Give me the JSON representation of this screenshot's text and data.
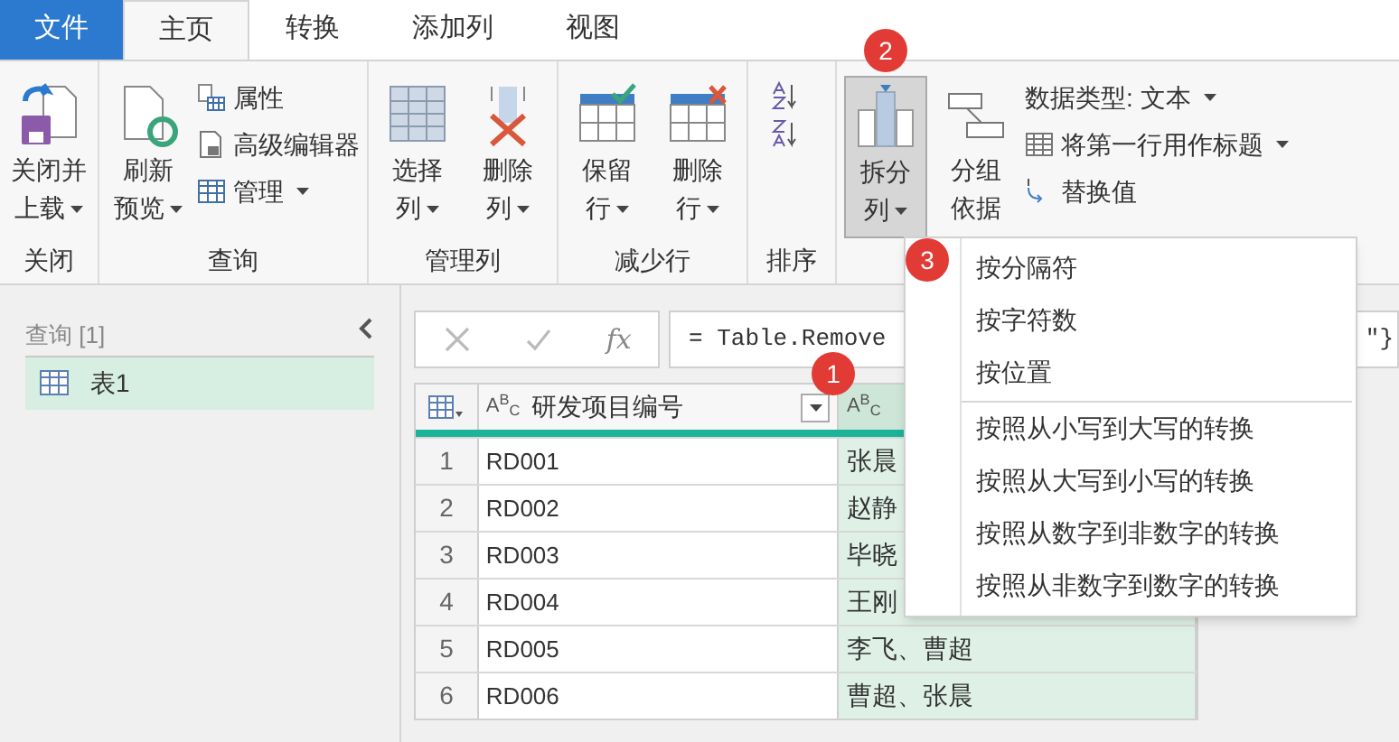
{
  "tabs": [
    {
      "label": "文件",
      "kind": "file",
      "selected": false
    },
    {
      "label": "主页",
      "kind": "tab",
      "selected": true
    },
    {
      "label": "转换",
      "kind": "tab",
      "selected": false
    },
    {
      "label": "添加列",
      "kind": "tab",
      "selected": false
    },
    {
      "label": "视图",
      "kind": "tab",
      "selected": false
    }
  ],
  "ribbon": {
    "groups": [
      {
        "kind": "buttons",
        "label": "关闭",
        "large": [
          {
            "lines": [
              "关闭并",
              "上载"
            ],
            "dropdown": true,
            "selected": false
          }
        ]
      },
      {
        "kind": "buttons",
        "label": "查询",
        "large": [
          {
            "lines": [
              "刷新",
              "预览"
            ],
            "dropdown": true,
            "selected": false
          }
        ],
        "small": [
          {
            "label": "属性",
            "dropdown": false
          },
          {
            "label": "高级编辑器",
            "dropdown": false
          },
          {
            "label": "管理",
            "dropdown": true
          }
        ]
      },
      {
        "kind": "buttons",
        "label": "管理列",
        "large": [
          {
            "lines": [
              "选择",
              "列"
            ],
            "dropdown": true,
            "selected": false
          },
          {
            "lines": [
              "删除",
              "列"
            ],
            "dropdown": true,
            "selected": false
          }
        ]
      },
      {
        "kind": "buttons",
        "label": "减少行",
        "large": [
          {
            "lines": [
              "保留",
              "行"
            ],
            "dropdown": true,
            "selected": false
          },
          {
            "lines": [
              "删除",
              "行"
            ],
            "dropdown": true,
            "selected": false
          }
        ]
      },
      {
        "kind": "sort",
        "label": "排序"
      },
      {
        "kind": "buttons",
        "large": [
          {
            "lines": [
              "拆分",
              "列"
            ],
            "dropdown": true,
            "selected": true
          },
          {
            "lines": [
              "分组",
              "依据"
            ],
            "dropdown": false,
            "selected": false
          }
        ],
        "small": [
          {
            "label": "数据类型: 文本",
            "dropdown": true
          },
          {
            "label": "将第一行用作标题",
            "dropdown": true
          },
          {
            "label": "替换值",
            "dropdown": false
          }
        ]
      }
    ]
  },
  "queries": {
    "header": "查询 [1]",
    "items": [
      {
        "label": "表1",
        "selected": true
      }
    ]
  },
  "formula_bar": {
    "fx": "fx",
    "formula_start": "= Table.Remove",
    "formula_end": "\"}"
  },
  "table": {
    "columns": [
      {
        "name": "研发项目编号",
        "type": "A$^{B}$$_{C}$",
        "selected": false
      },
      {
        "type": "A$^{B}$$_{C}$",
        "selected": true
      }
    ],
    "rows": [
      {
        "index": "1",
        "cells": [
          "RD001",
          "张晨"
        ]
      },
      {
        "index": "2",
        "cells": [
          "RD002",
          "赵静"
        ]
      },
      {
        "index": "3",
        "cells": [
          "RD003",
          "毕晓"
        ]
      },
      {
        "index": "4",
        "cells": [
          "RD004",
          "王刚"
        ]
      },
      {
        "index": "5",
        "cells": [
          "RD005",
          "李飞、曹超"
        ]
      },
      {
        "index": "6",
        "cells": [
          "RD006",
          "曹超、张晨"
        ]
      }
    ]
  },
  "split_menu": {
    "items": [
      {
        "label": "按分隔符",
        "separator_before": false
      },
      {
        "label": "按字符数",
        "separator_before": false
      },
      {
        "label": "按位置",
        "separator_before": false
      },
      {
        "label": "按照从小写到大写的转换",
        "separator_before": true
      },
      {
        "label": "按照从大写到小写的转换",
        "separator_before": false
      },
      {
        "label": "按照从数字到非数字的转换",
        "separator_before": false
      },
      {
        "label": "按照从非数字到数字的转换",
        "separator_before": false
      }
    ]
  },
  "badges": [
    {
      "label": "1"
    },
    {
      "label": "2"
    },
    {
      "label": "3"
    }
  ]
}
